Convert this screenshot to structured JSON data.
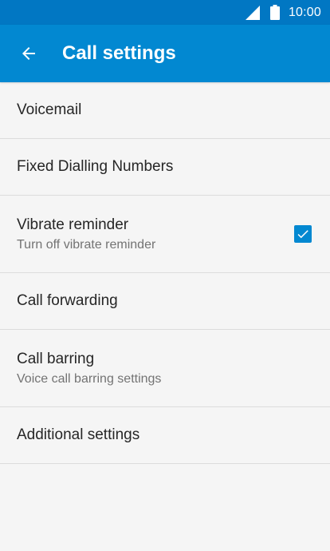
{
  "status_bar": {
    "time": "10:00",
    "icons": [
      "signal-icon",
      "battery-icon"
    ]
  },
  "app_bar": {
    "title": "Call settings",
    "back_icon": "arrow-back-icon"
  },
  "colors": {
    "status_bar": "#0177c3",
    "app_bar": "#0288d1",
    "background": "#f5f5f5",
    "checkbox": "#0288d1"
  },
  "settings": [
    {
      "title": "Voicemail"
    },
    {
      "title": "Fixed Dialling Numbers"
    },
    {
      "title": "Vibrate reminder",
      "summary": "Turn off vibrate reminder",
      "checked": true
    },
    {
      "title": "Call forwarding"
    },
    {
      "title": "Call barring",
      "summary": "Voice call barring settings"
    },
    {
      "title": "Additional settings"
    }
  ]
}
